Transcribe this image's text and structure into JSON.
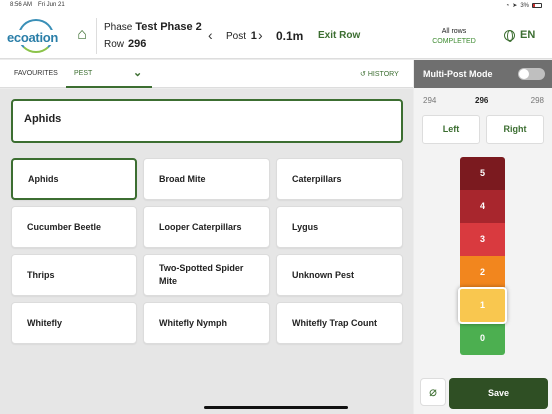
{
  "statusbar": {
    "time": "8:56 AM",
    "date": "Fri Jun 21",
    "battery": "3%"
  },
  "header": {
    "logo_text": "ecoation",
    "phase_label": "Phase",
    "phase_value": "Test Phase 2",
    "row_label": "Row",
    "row_value": "296",
    "post_label": "Post",
    "post_value": "1",
    "distance": "0.1m",
    "exit_row": "Exit Row",
    "all_rows_label": "All rows",
    "all_rows_status": "COMPLETED",
    "language": "EN"
  },
  "tabs": {
    "favourites": "FAVOURITES",
    "pest": "PEST",
    "history": "HISTORY"
  },
  "selected_pest": "Aphids",
  "pests": [
    {
      "label": "Aphids"
    },
    {
      "label": "Broad Mite"
    },
    {
      "label": "Caterpillars"
    },
    {
      "label": "Cucumber Beetle"
    },
    {
      "label": "Looper Caterpillars"
    },
    {
      "label": "Lygus"
    },
    {
      "label": "Thrips"
    },
    {
      "label": "Two-Spotted Spider Mite"
    },
    {
      "label": "Unknown Pest"
    },
    {
      "label": "Whitefly"
    },
    {
      "label": "Whitefly Nymph"
    },
    {
      "label": "Whitefly Trap Count"
    }
  ],
  "panel": {
    "title": "Multi-Post Mode",
    "post_prev": "294",
    "post_current": "296",
    "post_next": "298",
    "left_label": "Left",
    "right_label": "Right",
    "levels": [
      "5",
      "4",
      "3",
      "2",
      "1",
      "0"
    ],
    "selected_level": "1",
    "save_label": "Save"
  },
  "colors": {
    "accent": "#3c6e31",
    "save": "#2f4f24",
    "level5": "#7b1a1f",
    "level4": "#a8262d",
    "level3": "#d93a3f",
    "level2": "#f2861e",
    "level1": "#f9c74f",
    "level0": "#4caf50"
  }
}
